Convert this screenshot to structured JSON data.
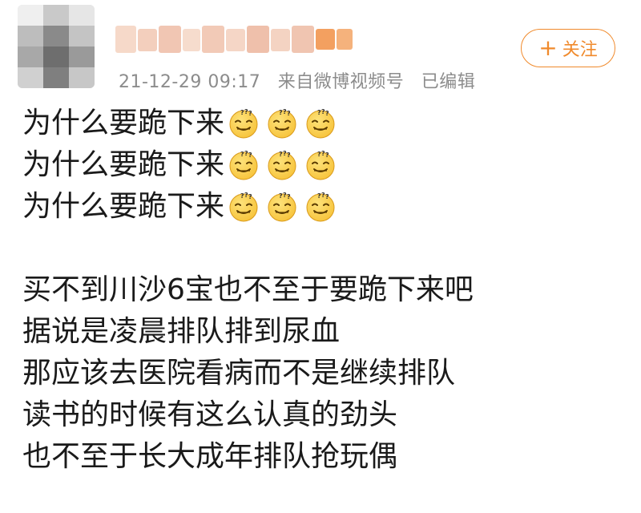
{
  "post": {
    "meta": {
      "timestamp": "21-12-29 09:17",
      "source": "来自微博视频号",
      "edited": "已编辑"
    },
    "follow_button": {
      "label": "关注",
      "icon": "plus-icon"
    },
    "repeat_lines": [
      {
        "text": "为什么要跪下来",
        "emoji": "dizzy-face-emoji",
        "emoji_count": 3
      },
      {
        "text": "为什么要跪下来",
        "emoji": "dizzy-face-emoji",
        "emoji_count": 3
      },
      {
        "text": "为什么要跪下来",
        "emoji": "dizzy-face-emoji",
        "emoji_count": 3
      }
    ],
    "body_lines": [
      "买不到川沙6宝也不至于要跪下来吧",
      "据说是凌晨排队排到尿血",
      "那应该去医院看病而不是继续排队",
      "读书的时候有这么认真的劲头",
      "也不至于长大成年排队抢玩偶"
    ]
  },
  "colors": {
    "accent": "#f08a2c",
    "meta_text": "#8c8c8c",
    "body_text": "#1a1a1a",
    "emoji_face": "#f7c33a"
  }
}
